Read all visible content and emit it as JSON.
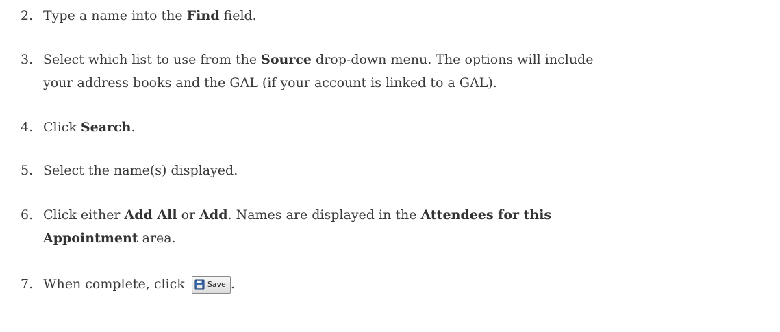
{
  "steps": [
    {
      "num": "2.",
      "pre": "Type a name into the ",
      "bold1": "Find",
      "post": " field."
    },
    {
      "num": "3.",
      "pre": "Select which list to use from the ",
      "bold1": "Source",
      "post": " drop-down menu. The options will include",
      "line2": "your address books and the GAL (if your account is linked to a GAL)."
    },
    {
      "num": "4.",
      "pre": "Click ",
      "bold1": "Search",
      "post": "."
    },
    {
      "num": "5.",
      "text": "Select the name(s) displayed."
    },
    {
      "num": "6.",
      "pre": "Click either ",
      "bold1": "Add All",
      "mid": " or ",
      "bold2": "Add",
      "mid2": ". Names are displayed in the ",
      "bold3": "Attendees for this",
      "bold3b": "Appointment",
      "post": " area."
    },
    {
      "num": "7.",
      "pre": "When complete, click ",
      "post": "."
    }
  ],
  "save_button": {
    "label": "Save",
    "icon": "floppy-disk-icon"
  }
}
